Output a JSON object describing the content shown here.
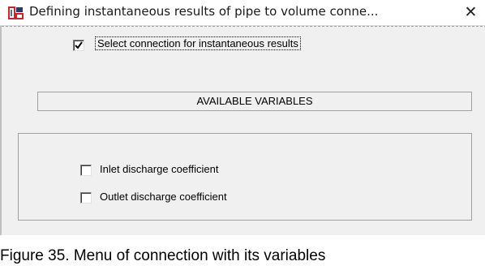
{
  "window": {
    "title": "Defining instantaneous results of pipe to volume conne...",
    "close_glyph": "✕"
  },
  "select_connection": {
    "label": "Select connection for instantaneous results",
    "checked": true
  },
  "available_variables": {
    "header": "AVAILABLE VARIABLES",
    "items": [
      {
        "label": "Inlet discharge coefficient",
        "checked": false
      },
      {
        "label": "Outlet discharge coefficient",
        "checked": false
      }
    ]
  },
  "buttons": [
    {
      "icon": "checkmark-icon",
      "color": "#1f9b2e"
    },
    {
      "icon": "cross-icon",
      "color": "#d42020"
    }
  ],
  "caption": "Figure 35. Menu of connection with its variables"
}
